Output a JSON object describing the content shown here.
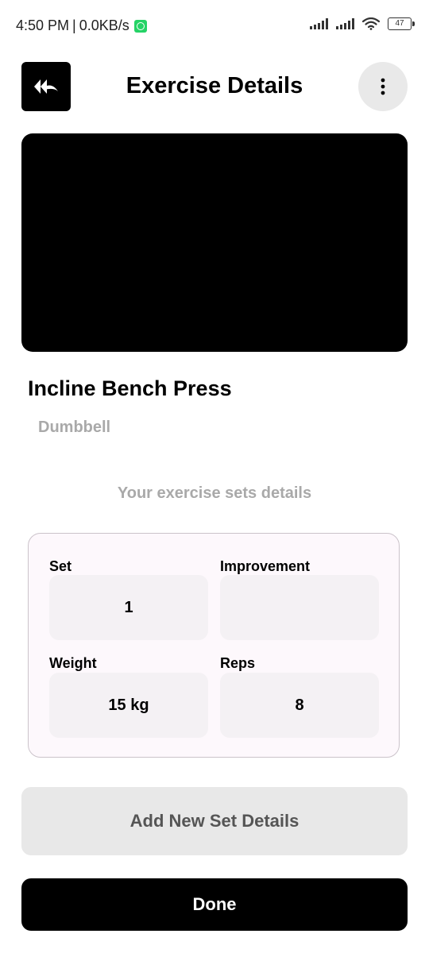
{
  "status_bar": {
    "time": "4:50 PM",
    "separator": "|",
    "speed": "0.0KB/s",
    "battery": "47"
  },
  "header": {
    "title": "Exercise Details",
    "back_icon": "double-arrow-back-icon",
    "more_icon": "vertical-ellipsis-icon"
  },
  "exercise": {
    "name": "Incline Bench Press",
    "equipment": "Dumbbell"
  },
  "sets_caption": "Your exercise sets details",
  "set_card": {
    "set_label": "Set",
    "set_value": "1",
    "improvement_label": "Improvement",
    "improvement_value": "",
    "weight_label": "Weight",
    "weight_value": "15 kg",
    "reps_label": "Reps",
    "reps_value": "8"
  },
  "buttons": {
    "add_set": "Add New Set Details",
    "done": "Done"
  },
  "colors": {
    "primary": "#000000",
    "muted_text": "#a9a9a9",
    "card_bg": "#fdf8fc",
    "field_bg": "#f4f1f4",
    "secondary_button_bg": "#e8e8e8"
  }
}
